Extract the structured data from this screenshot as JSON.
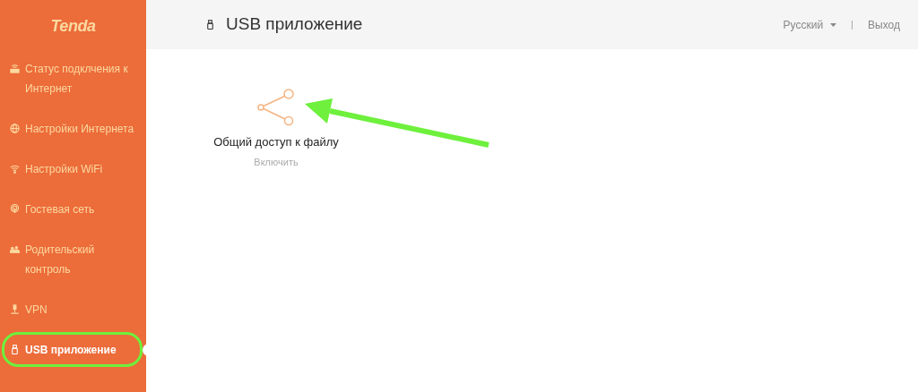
{
  "sidebar": {
    "logo": "Tenda",
    "items": [
      {
        "kind": "router",
        "label": "Статус подклчения к Интернет",
        "selected": false
      },
      {
        "kind": "globe",
        "label": "Настройки Интернета",
        "selected": false
      },
      {
        "kind": "wifi",
        "label": "Настройки WiFi",
        "selected": false
      },
      {
        "kind": "guest",
        "label": "Гостевая сеть",
        "selected": false
      },
      {
        "kind": "family",
        "label": "Родительский контроль",
        "selected": false
      },
      {
        "kind": "vpn",
        "label": "VPN",
        "selected": false
      },
      {
        "kind": "usb",
        "label": "USB приложение",
        "selected": true
      }
    ]
  },
  "header": {
    "title": "USB приложение",
    "language": "Русский",
    "logout": "Выход"
  },
  "apps": [
    {
      "name": "Общий доступ к файлу",
      "action": "Включить"
    }
  ]
}
